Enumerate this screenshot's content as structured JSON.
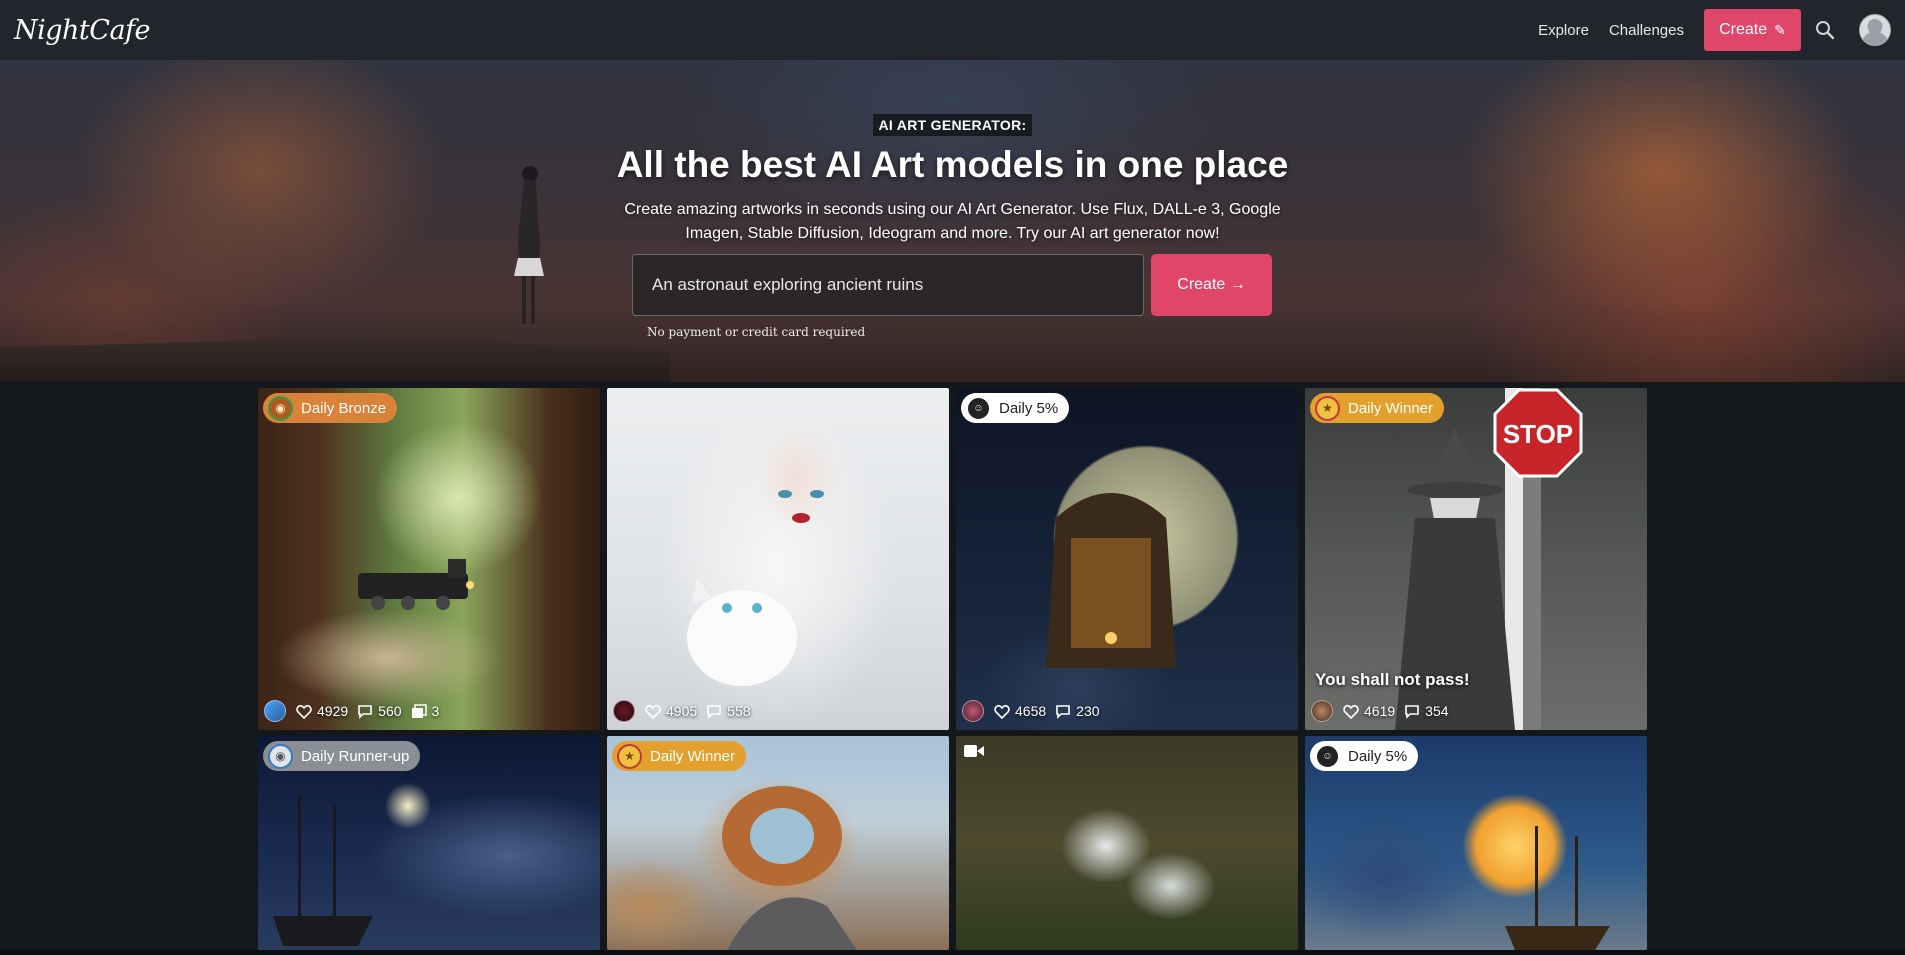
{
  "nav": {
    "logo": "NightCafe",
    "links": [
      "Explore",
      "Challenges"
    ],
    "create_label": "Create"
  },
  "hero": {
    "kicker": "AI ART GENERATOR:",
    "headline": "All the best AI Art models in one place",
    "subtext": "Create amazing artworks in seconds using our AI Art Generator. Use Flux, DALL-e 3, Google Imagen, Stable Diffusion, Ideogram and more. Try our AI art generator now!",
    "prompt_value": "An astronaut exploring ancient ruins",
    "create_label": "Create →",
    "note": "No payment or credit card required"
  },
  "cards": [
    {
      "badge": "Daily Bronze",
      "likes": "4929",
      "comments": "560",
      "images": "3",
      "caption": ""
    },
    {
      "badge": "",
      "likes": "4905",
      "comments": "558",
      "caption": ""
    },
    {
      "badge": "Daily 5%",
      "likes": "4658",
      "comments": "230",
      "caption": ""
    },
    {
      "badge": "Daily Winner",
      "likes": "4619",
      "comments": "354",
      "caption": "You shall not pass!"
    },
    {
      "badge": "Daily Runner-up"
    },
    {
      "badge": "Daily Winner"
    },
    {
      "badge": ""
    },
    {
      "badge": "Daily 5%"
    }
  ],
  "colors": {
    "accent": "#e0456a",
    "navbar": "#22262c",
    "background": "#14171c"
  }
}
